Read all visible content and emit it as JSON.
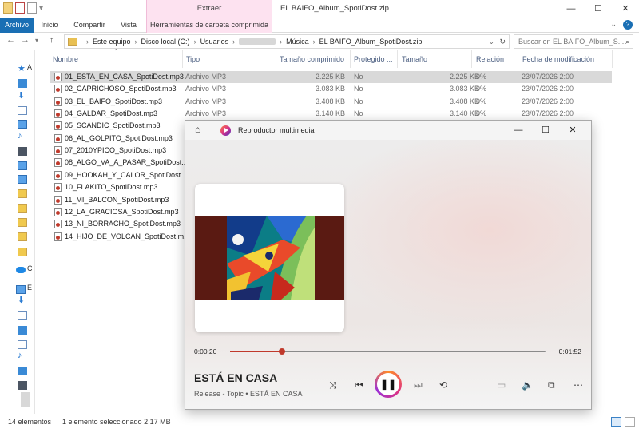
{
  "window": {
    "title": "EL BAIFO_Album_SpotiDost.zip",
    "context_tab_top": "Extraer"
  },
  "ribbon": {
    "tabs": [
      "Archivo",
      "Inicio",
      "Compartir",
      "Vista",
      "Herramientas de carpeta comprimida"
    ]
  },
  "address": {
    "segments": [
      "Este equipo",
      "Disco local (C:)",
      "Usuarios",
      "Música",
      "EL BAIFO_Album_SpotiDost.zip"
    ],
    "search_placeholder": "Buscar en EL BAIFO_Album_S..."
  },
  "nav_letters": [
    "A",
    "C",
    "E"
  ],
  "columns": [
    "Nombre",
    "Tipo",
    "Tamaño comprimido",
    "Protegido ...",
    "Tamaño",
    "Relación",
    "Fecha de modificación"
  ],
  "files": [
    {
      "name": "01_ESTA_EN_CASA_SpotiDost.mp3",
      "type": "Archivo MP3",
      "csize": "2.225 KB",
      "prot": "No",
      "size": "2.225 KB",
      "ratio": "0%",
      "date": "23/07/2026 2:00"
    },
    {
      "name": "02_CAPRICHOSO_SpotiDost.mp3",
      "type": "Archivo MP3",
      "csize": "3.083 KB",
      "prot": "No",
      "size": "3.083 KB",
      "ratio": "0%",
      "date": "23/07/2026 2:00"
    },
    {
      "name": "03_EL_BAIFO_SpotiDost.mp3",
      "type": "Archivo MP3",
      "csize": "3.408 KB",
      "prot": "No",
      "size": "3.408 KB",
      "ratio": "0%",
      "date": "23/07/2026 2:00"
    },
    {
      "name": "04_GALDAR_SpotiDost.mp3",
      "type": "Archivo MP3",
      "csize": "3.140 KB",
      "prot": "No",
      "size": "3.140 KB",
      "ratio": "0%",
      "date": "23/07/2026 2:00"
    },
    {
      "name": "05_SCANDIC_SpotiDost.mp3",
      "type": "",
      "csize": "",
      "prot": "",
      "size": "",
      "ratio": "",
      "date": ""
    },
    {
      "name": "06_AL_GOLPITO_SpotiDost.mp3",
      "type": "",
      "csize": "",
      "prot": "",
      "size": "",
      "ratio": "",
      "date": ""
    },
    {
      "name": "07_2010YPICO_SpotiDost.mp3",
      "type": "",
      "csize": "",
      "prot": "",
      "size": "",
      "ratio": "",
      "date": ""
    },
    {
      "name": "08_ALGO_VA_A_PASAR_SpotiDost....",
      "type": "",
      "csize": "",
      "prot": "",
      "size": "",
      "ratio": "",
      "date": ""
    },
    {
      "name": "09_HOOKAH_Y_CALOR_SpotiDost....",
      "type": "",
      "csize": "",
      "prot": "",
      "size": "",
      "ratio": "",
      "date": ""
    },
    {
      "name": "10_FLAKITO_SpotiDost.mp3",
      "type": "",
      "csize": "",
      "prot": "",
      "size": "",
      "ratio": "",
      "date": ""
    },
    {
      "name": "11_MI_BALCON_SpotiDost.mp3",
      "type": "",
      "csize": "",
      "prot": "",
      "size": "",
      "ratio": "",
      "date": ""
    },
    {
      "name": "12_LA_GRACIOSA_SpotiDost.mp3",
      "type": "",
      "csize": "",
      "prot": "",
      "size": "",
      "ratio": "",
      "date": ""
    },
    {
      "name": "13_NI_BORRACHO_SpotiDost.mp3",
      "type": "",
      "csize": "",
      "prot": "",
      "size": "",
      "ratio": "",
      "date": ""
    },
    {
      "name": "14_HIJO_DE_VOLCAN_SpotiDost.m...",
      "type": "",
      "csize": "",
      "prot": "",
      "size": "",
      "ratio": "",
      "date": ""
    }
  ],
  "status": {
    "count": "14 elementos",
    "selection": "1 elemento seleccionado  2,17 MB"
  },
  "player": {
    "app_title": "Reproductor multimedia",
    "elapsed": "0:00:20",
    "total": "0:01:52",
    "progress_fraction": 0.165,
    "song": "ESTÁ EN CASA",
    "artist_line": "Release - Topic • ESTÁ EN CASA",
    "accent": "#c0392b"
  }
}
